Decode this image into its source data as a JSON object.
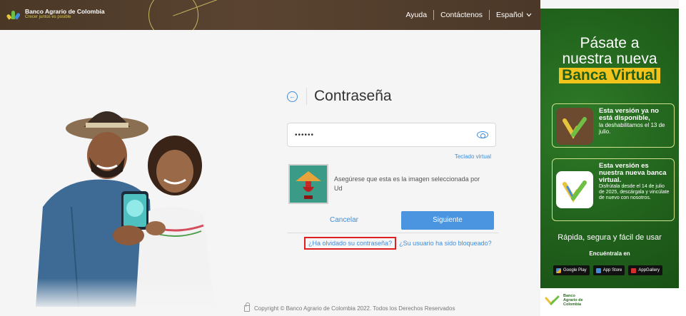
{
  "topbar": {
    "brand_name": "Banco Agrario de Colombia",
    "brand_tagline": "Crecer juntos es posible",
    "nav": {
      "help": "Ayuda",
      "contact": "Contáctenos",
      "language": "Español"
    }
  },
  "form": {
    "title": "Contraseña",
    "password_value": "••••••",
    "virtual_keyboard": "Teclado virtual",
    "image_message": "Asegúrese que esta es la imagen seleccionada por Ud",
    "cancel_label": "Cancelar",
    "next_label": "Siguiente",
    "forgot_link": "¿Ha olvidado su contraseña?",
    "blocked_link": "¿Su usuario ha sido bloqueado?"
  },
  "footer": {
    "copyright": "Copyright © Banco Agrario de Colombia 2022. Todos los Derechos Reservados"
  },
  "promo": {
    "head_line1": "Pásate a",
    "head_line2": "nuestra nueva",
    "head_highlight": "Banca Virtual",
    "card1_title": "Esta versión ya no está disponible,",
    "card1_body": "la deshabilitamos el 13 de julio.",
    "card2_title": "Esta versión es nuestra nueva banca virtual.",
    "card2_body": "Disfrútala desde el 14 de julio de 2025, descárgala y vincúlate de nuevo con nosotros.",
    "tagline": "Rápida, segura y fácil de usar",
    "find": "Encuéntrala en",
    "stores": [
      "Google Play",
      "App Store",
      "AppGallery"
    ],
    "footer_logo": "Banco Agrario de Colombia"
  },
  "colors": {
    "topbar": "#4a3726",
    "accent": "#4a94e0",
    "promo_green": "#21621c",
    "highlight_yellow": "#f2c41b",
    "forgot_outline": "#e02020"
  }
}
